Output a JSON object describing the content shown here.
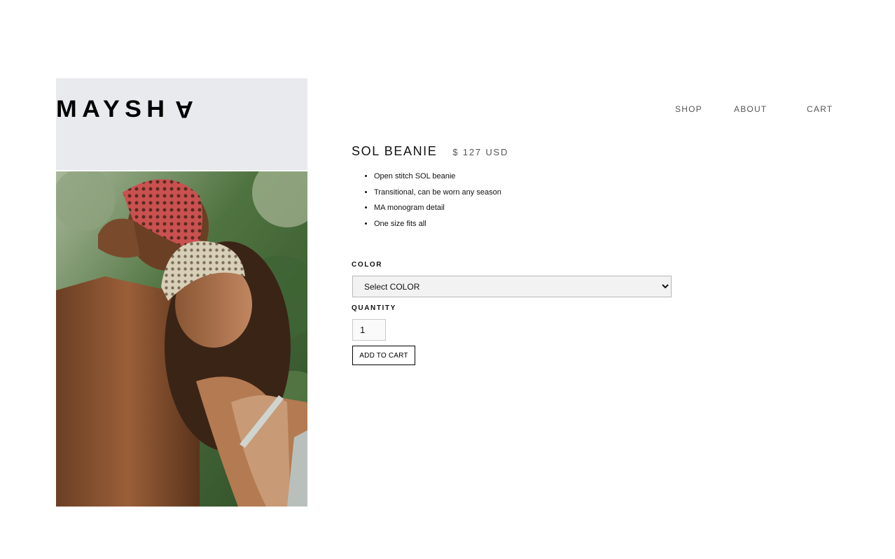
{
  "brand": {
    "logo_text_main": "MAYSH",
    "logo_text_flipped": "A"
  },
  "nav": {
    "shop": "SHOP",
    "about": "ABOUT",
    "cart": "CART"
  },
  "product": {
    "title": "SOL BEANIE",
    "price": "$ 127 USD",
    "features": [
      "Open stitch SOL beanie",
      "Transitional, can be worn any season",
      "MA monogram detail",
      "One size fits all"
    ]
  },
  "form": {
    "color_label": "COLOR",
    "color_selected": "Select COLOR",
    "quantity_label": "QUANTITY",
    "quantity_value": "1",
    "add_to_cart": "ADD TO CART"
  },
  "colors": {
    "logo_panel_bg": "#e9eaee",
    "select_bg": "#f2f2f2",
    "nav_text": "#555555"
  }
}
